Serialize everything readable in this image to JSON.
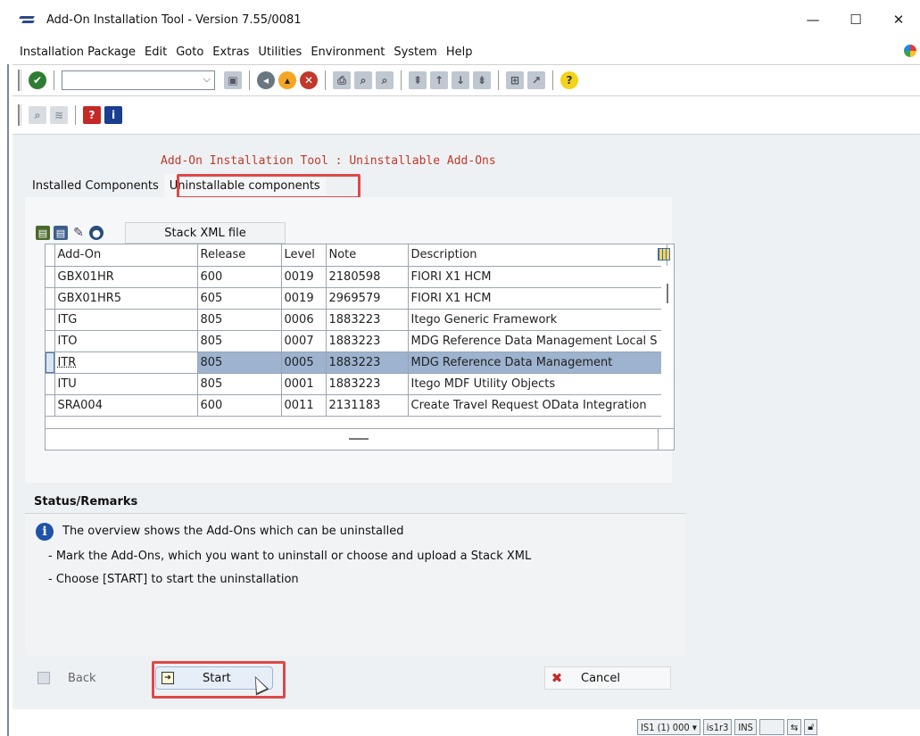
{
  "window": {
    "title": "Add-On Installation Tool - Version 7.55/0081",
    "minimize": "—",
    "maximize": "☐",
    "close": "✕"
  },
  "menu": [
    "Installation Package",
    "Edit",
    "Goto",
    "Extras",
    "Utilities",
    "Environment",
    "System",
    "Help"
  ],
  "toolbar": {
    "command_value": "",
    "icons": [
      "ok-icon",
      "save-icon",
      "back-icon",
      "exit-icon",
      "cancel-icon",
      "print-icon",
      "find-icon",
      "find-next-icon",
      "first-page-icon",
      "previous-page-icon",
      "next-page-icon",
      "last-page-icon",
      "new-session-icon",
      "shortcut-icon",
      "help-icon"
    ]
  },
  "heading": "Add-On Installation Tool : Uninstallable Add-Ons",
  "tabs": [
    {
      "label": "Installed Components"
    },
    {
      "label": "Uninstallable components"
    }
  ],
  "alv": {
    "stack_button": "Stack XML file",
    "columns": [
      "Add-On",
      "Release",
      "Level",
      "Note",
      "Description"
    ],
    "rows": [
      {
        "addon": "GBX01HR",
        "release": "600",
        "level": "0019",
        "note": "2180598",
        "description": "FIORI X1 HCM"
      },
      {
        "addon": "GBX01HR5",
        "release": "605",
        "level": "0019",
        "note": "2969579",
        "description": "FIORI X1 HCM"
      },
      {
        "addon": "ITG",
        "release": "805",
        "level": "0006",
        "note": "1883223",
        "description": "Itego Generic Framework"
      },
      {
        "addon": "ITO",
        "release": "805",
        "level": "0007",
        "note": "1883223",
        "description": "MDG Reference Data Management Local S"
      },
      {
        "addon": "ITR",
        "release": "805",
        "level": "0005",
        "note": "1883223",
        "description": "MDG Reference Data Management"
      },
      {
        "addon": "ITU",
        "release": "805",
        "level": "0001",
        "note": "1883223",
        "description": "Itego MDF Utility Objects"
      },
      {
        "addon": "SRA004",
        "release": "600",
        "level": "0011",
        "note": "2131183",
        "description": "Create Travel Request OData Integration"
      }
    ]
  },
  "status": {
    "title": "Status/Remarks",
    "line1": "The overview shows the Add-Ons which can be uninstalled",
    "line2": "- Mark the Add-Ons, which you want to uninstall or choose and upload a Stack XML",
    "line3": "- Choose [START] to start the uninstallation"
  },
  "buttons": {
    "back": "Back",
    "start": "Start",
    "cancel": "Cancel"
  },
  "statusbar": {
    "system": "IS1 (1) 000 ▾",
    "server": "is1r3",
    "mode": "INS"
  },
  "colors": {
    "highlight": "#e04848",
    "heading": "#c0392b",
    "selected_row": "#9db3cf"
  }
}
